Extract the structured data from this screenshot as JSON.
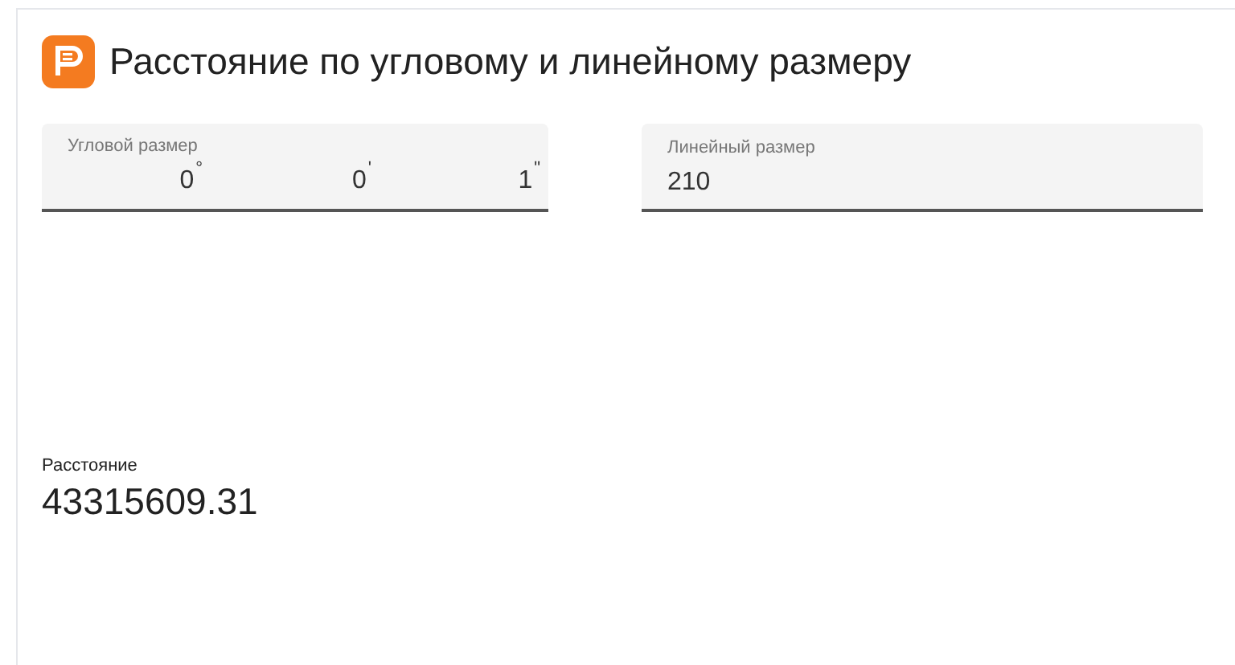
{
  "title": "Расстояние по угловому и линейному размеру",
  "angular_size": {
    "label": "Угловой размер",
    "parts": [
      {
        "value": "0",
        "unit": "°"
      },
      {
        "value": "0",
        "unit": "'"
      },
      {
        "value": "1",
        "unit": "\""
      }
    ]
  },
  "linear_size": {
    "label": "Линейный размер",
    "value": "210"
  },
  "result": {
    "label": "Расстояние",
    "value": "43315609.31"
  }
}
